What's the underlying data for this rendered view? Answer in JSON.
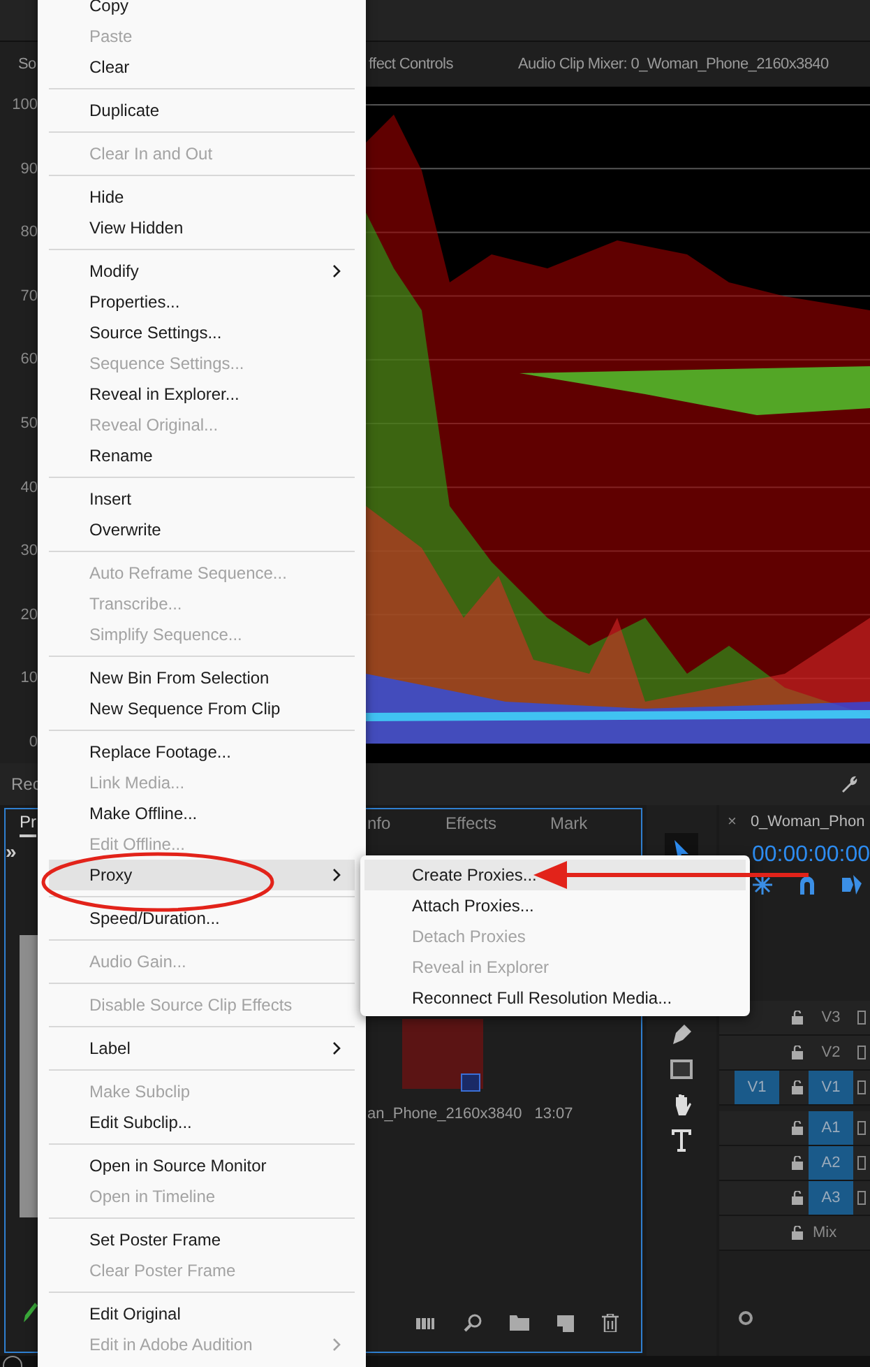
{
  "top_panel": {
    "tabs": [
      {
        "label": "So",
        "selected": false
      },
      {
        "label": "ffect Controls",
        "selected": false
      },
      {
        "label": "Audio Clip Mixer: 0_Woman_Phone_2160x3840",
        "selected": false
      }
    ]
  },
  "scope": {
    "scale": [
      "100",
      "90",
      "80",
      "70",
      "60",
      "50",
      "40",
      "30",
      "20",
      "10",
      "0"
    ]
  },
  "lower_header": {
    "label": "Rec"
  },
  "project_panel": {
    "tabs": [
      {
        "label": "Pr",
        "selected": true
      },
      {
        "label": "nfo",
        "selected": false
      },
      {
        "label": "Effects",
        "selected": false
      },
      {
        "label": "Mark",
        "selected": false
      }
    ],
    "more": "»",
    "clip": {
      "name": "an_Phone_2160x3840",
      "duration": "13:07"
    }
  },
  "timeline": {
    "close": "×",
    "title": "0_Woman_Phon",
    "timecode": "00:00:00:00",
    "tracks": [
      {
        "kind": "video",
        "label": "V3",
        "targeted": false
      },
      {
        "kind": "video",
        "label": "V2",
        "targeted": false
      },
      {
        "kind": "video",
        "label": "V1",
        "source": "V1",
        "targeted": true
      },
      {
        "kind": "audio",
        "label": "A1",
        "targeted": true
      },
      {
        "kind": "audio",
        "label": "A2",
        "targeted": true
      },
      {
        "kind": "audio",
        "label": "A3",
        "targeted": true
      },
      {
        "kind": "mix",
        "label": "Mix"
      }
    ]
  },
  "context_menu": {
    "sections": [
      [
        {
          "label": "Copy",
          "disabled": false,
          "submenu": false,
          "highlighted": false
        },
        {
          "label": "Paste",
          "disabled": true,
          "submenu": false,
          "highlighted": false
        },
        {
          "label": "Clear",
          "disabled": false,
          "submenu": false,
          "highlighted": false
        }
      ],
      [
        {
          "label": "Duplicate",
          "disabled": false,
          "submenu": false,
          "highlighted": false
        }
      ],
      [
        {
          "label": "Clear In and Out",
          "disabled": true,
          "submenu": false,
          "highlighted": false
        }
      ],
      [
        {
          "label": "Hide",
          "disabled": false,
          "submenu": false,
          "highlighted": false
        },
        {
          "label": "View Hidden",
          "disabled": false,
          "submenu": false,
          "highlighted": false
        }
      ],
      [
        {
          "label": "Modify",
          "disabled": false,
          "submenu": true,
          "highlighted": false
        },
        {
          "label": "Properties...",
          "disabled": false,
          "submenu": false,
          "highlighted": false
        },
        {
          "label": "Source Settings...",
          "disabled": false,
          "submenu": false,
          "highlighted": false
        },
        {
          "label": "Sequence Settings...",
          "disabled": true,
          "submenu": false,
          "highlighted": false
        },
        {
          "label": "Reveal in Explorer...",
          "disabled": false,
          "submenu": false,
          "highlighted": false
        },
        {
          "label": "Reveal Original...",
          "disabled": true,
          "submenu": false,
          "highlighted": false
        },
        {
          "label": "Rename",
          "disabled": false,
          "submenu": false,
          "highlighted": false
        }
      ],
      [
        {
          "label": "Insert",
          "disabled": false,
          "submenu": false,
          "highlighted": false
        },
        {
          "label": "Overwrite",
          "disabled": false,
          "submenu": false,
          "highlighted": false
        }
      ],
      [
        {
          "label": "Auto Reframe Sequence...",
          "disabled": true,
          "submenu": false,
          "highlighted": false
        },
        {
          "label": "Transcribe...",
          "disabled": true,
          "submenu": false,
          "highlighted": false
        },
        {
          "label": "Simplify Sequence...",
          "disabled": true,
          "submenu": false,
          "highlighted": false
        }
      ],
      [
        {
          "label": "New Bin From Selection",
          "disabled": false,
          "submenu": false,
          "highlighted": false
        },
        {
          "label": "New Sequence From Clip",
          "disabled": false,
          "submenu": false,
          "highlighted": false
        }
      ],
      [
        {
          "label": "Replace Footage...",
          "disabled": false,
          "submenu": false,
          "highlighted": false
        },
        {
          "label": "Link Media...",
          "disabled": true,
          "submenu": false,
          "highlighted": false
        },
        {
          "label": "Make Offline...",
          "disabled": false,
          "submenu": false,
          "highlighted": false
        },
        {
          "label": "Edit Offline...",
          "disabled": true,
          "submenu": false,
          "highlighted": false
        },
        {
          "label": "Proxy",
          "disabled": false,
          "submenu": true,
          "highlighted": true
        }
      ],
      [
        {
          "label": "Speed/Duration...",
          "disabled": false,
          "submenu": false,
          "highlighted": false
        }
      ],
      [
        {
          "label": "Audio Gain...",
          "disabled": true,
          "submenu": false,
          "highlighted": false
        }
      ],
      [
        {
          "label": "Disable Source Clip Effects",
          "disabled": true,
          "submenu": false,
          "highlighted": false
        }
      ],
      [
        {
          "label": "Label",
          "disabled": false,
          "submenu": true,
          "highlighted": false
        }
      ],
      [
        {
          "label": "Make Subclip",
          "disabled": true,
          "submenu": false,
          "highlighted": false
        },
        {
          "label": "Edit Subclip...",
          "disabled": false,
          "submenu": false,
          "highlighted": false
        }
      ],
      [
        {
          "label": "Open in Source Monitor",
          "disabled": false,
          "submenu": false,
          "highlighted": false
        },
        {
          "label": "Open in Timeline",
          "disabled": true,
          "submenu": false,
          "highlighted": false
        }
      ],
      [
        {
          "label": "Set Poster Frame",
          "disabled": false,
          "submenu": false,
          "highlighted": false
        },
        {
          "label": "Clear Poster Frame",
          "disabled": true,
          "submenu": false,
          "highlighted": false
        }
      ],
      [
        {
          "label": "Edit Original",
          "disabled": false,
          "submenu": false,
          "highlighted": false
        },
        {
          "label": "Edit in Adobe Audition",
          "disabled": true,
          "submenu": true,
          "highlighted": false
        }
      ]
    ]
  },
  "proxy_submenu": {
    "items": [
      {
        "label": "Create Proxies...",
        "disabled": false,
        "highlighted": true
      },
      {
        "label": "Attach Proxies...",
        "disabled": false,
        "highlighted": false
      },
      {
        "label": "Detach Proxies",
        "disabled": true,
        "highlighted": false
      },
      {
        "label": "Reveal in Explorer",
        "disabled": true,
        "highlighted": false
      },
      {
        "label": "Reconnect Full Resolution Media...",
        "disabled": false,
        "highlighted": false
      }
    ]
  }
}
